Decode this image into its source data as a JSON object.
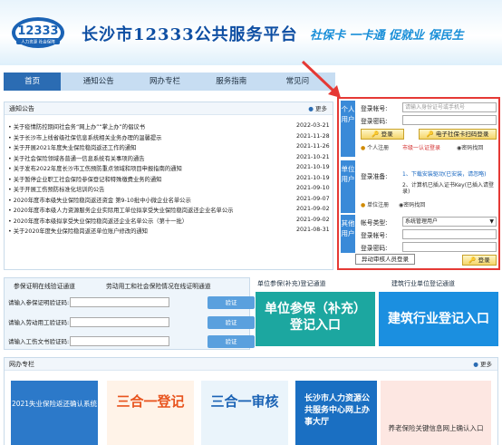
{
  "header": {
    "logo_number": "12333",
    "logo_sub": "人力资源 社会保障",
    "title": "长沙市12333公共服务平台",
    "slogan": "社保卡 一卡通 促就业 保民生"
  },
  "nav": [
    "首页",
    "通知公告",
    "网办专栏",
    "服务指南",
    "常见问"
  ],
  "notice": {
    "title": "通知公告",
    "more": "更多",
    "items": [
      {
        "t": "关于疫情防控期间社会务“网上办”“掌上办”的倡议书",
        "d": "2022-03-21"
      },
      {
        "t": "关于长沙市上线省级社保信息系统相关业务办理的温馨提示",
        "d": "2021-11-28"
      },
      {
        "t": "关于开展2021年度失业保险稳岗返还工作的通知",
        "d": "2021-11-26"
      },
      {
        "t": "关于社会保险领域各普通一信息系统有关事项的通告",
        "d": "2021-10-21"
      },
      {
        "t": "关于发布2022年度长沙市工伤预防重点领域和项目申报指南的通知",
        "d": "2021-10-19"
      },
      {
        "t": "关于暂停企业职工社会保险参保登记和特殊缴费业务的通知",
        "d": "2021-10-19"
      },
      {
        "t": "关于开展工伤预防标准化培训的公告",
        "d": "2021-09-10"
      },
      {
        "t": "2020年度市本级失业保险稳岗返还资金 第9-10批中小微企业名单公示",
        "d": "2021-09-07"
      },
      {
        "t": "2020年度市本级人力资源服务企业实际用工单位拟享受失业保险稳岗返还企业名单公示",
        "d": "2021-09-02"
      },
      {
        "t": "2020年度市本级拟享受失业保险稳岗返还企业名单公示（第十一批）",
        "d": "2021-09-02"
      },
      {
        "t": "关于2020年度失业保险稳岗返还单位账户修改的通知",
        "d": "2021-08-31"
      }
    ]
  },
  "login": {
    "personal_tab": "个人用户",
    "unit_tab": "单位用户",
    "other_tab": "其他用户",
    "account_label": "登录帐号:",
    "account_placeholder": "请输入身份证号或手机号",
    "password_label": "登录密码:",
    "login_btn": "登录",
    "card_scan_btn": "电子社保卡扫码登录",
    "register": "个人注册",
    "realname": "市级一认证登录",
    "forgot": "密码找回",
    "prep_label": "登录准备:",
    "prep1": "1、下载安装驱动(已安装，请忽略)",
    "prep2": "2、计算机已插入证书Key(已插入请登录)",
    "unit_register": "单位注册",
    "unit_forgot": "密码找回",
    "type_label": "帐号类型:",
    "type_value": "系统管理用户",
    "other_account": "登录帐号:",
    "other_pwd": "登录密码:",
    "staff_btn": "异动审核人员登录",
    "other_login": "登录"
  },
  "cert": {
    "tab1": "参保证明在线验证通道",
    "tab2": "劳动用工和社会保险情况在线证明通道",
    "rows": [
      {
        "label": "请输入参保证明验证码:",
        "btn": "验证"
      },
      {
        "label": "请输入劳动用工验证码:",
        "btn": "验证"
      },
      {
        "label": "请输入工伤文书验证码:",
        "btn": "验证"
      }
    ]
  },
  "unit_channel": {
    "title": "单位参保(补充)登记通道",
    "banner": "单位参保（补充）\n登记入口"
  },
  "build_channel": {
    "title": "建筑行业单位登记通道",
    "banner": "建筑行业登记入口"
  },
  "netdesk": {
    "title": "网办专栏",
    "more": "更多",
    "tiles": [
      "2021失业保险返还确认系统",
      "三合一登记",
      "三合一审核",
      "长沙市人力资源公共服务中心网上办事大厅",
      "养老保险关键信息网上确认入口"
    ]
  }
}
